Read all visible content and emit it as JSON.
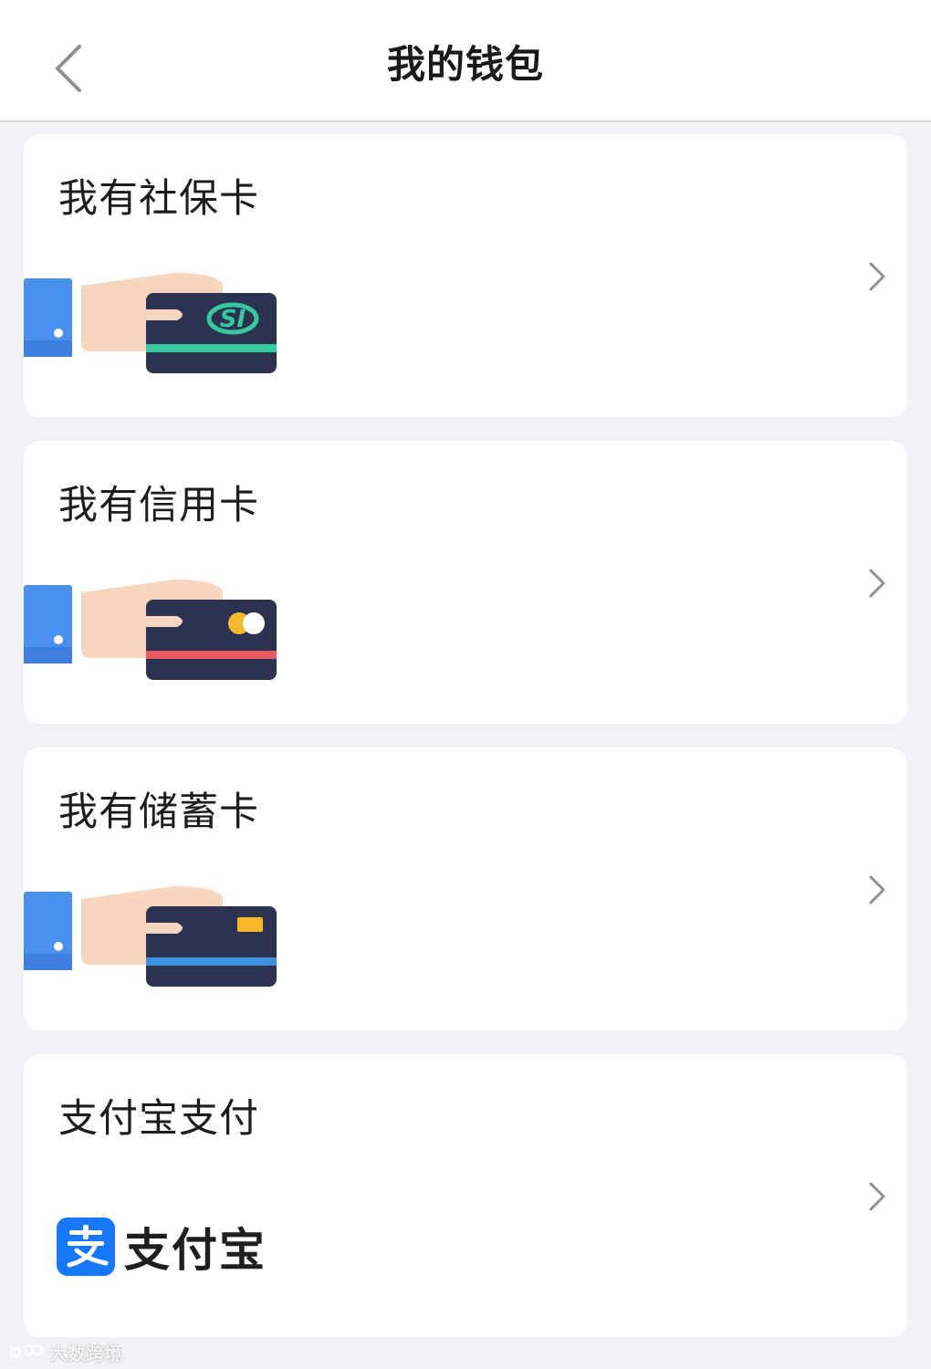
{
  "header": {
    "title": "我的钱包",
    "back_icon": "chevron-left-icon"
  },
  "cards": [
    {
      "title": "我有社保卡",
      "art": "social-security-card",
      "stripe_color": "#36c9a1",
      "badge_text": "SI"
    },
    {
      "title": "我有信用卡",
      "art": "credit-card",
      "stripe_color": "#e85a5f"
    },
    {
      "title": "我有储蓄卡",
      "art": "debit-card",
      "stripe_color": "#3f8fe0",
      "chip_color": "#f5b829"
    },
    {
      "title": "支付宝支付",
      "art": "alipay-logo",
      "logo_text": "支付宝",
      "logo_color": "#1677ff"
    }
  ],
  "watermark": {
    "text": "大数跨境"
  },
  "colors": {
    "background": "#f2f2f6",
    "card": "#ffffff",
    "card_body": "#2c3350",
    "sleeve": "#4a90f0",
    "hand": "#f7d6c0",
    "chevron": "#8e8e93"
  }
}
